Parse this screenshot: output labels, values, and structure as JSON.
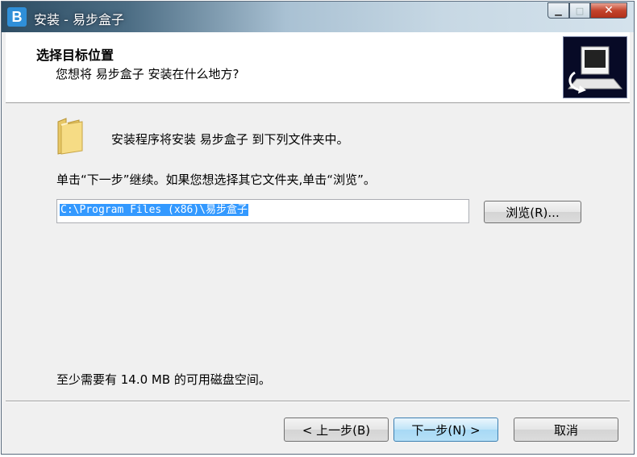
{
  "window": {
    "title": "安装 - 易步盒子",
    "app_icon_letter": "B",
    "controls": {
      "minimize": "▁",
      "maximize": "□",
      "close": "✕"
    }
  },
  "header": {
    "title": "选择目标位置",
    "subtitle": "您想将 易步盒子 安装在什么地方?"
  },
  "body": {
    "install_line": "安装程序将安装 易步盒子 到下列文件夹中。",
    "instruction": "单击“下一步”继续。如果您想选择其它文件夹,单击“浏览”。",
    "install_path": "C:\\Program Files (x86)\\易步盒子",
    "browse_label": "浏览(R)...",
    "disk_space": "至少需要有 14.0 MB 的可用磁盘空间。"
  },
  "footer": {
    "back_label": "< 上一步(B)",
    "next_label": "下一步(N) >",
    "cancel_label": "取消"
  },
  "colors": {
    "selection": "#3399ff",
    "header_image_bg": "#070a26",
    "close_button": "#c4442c"
  }
}
